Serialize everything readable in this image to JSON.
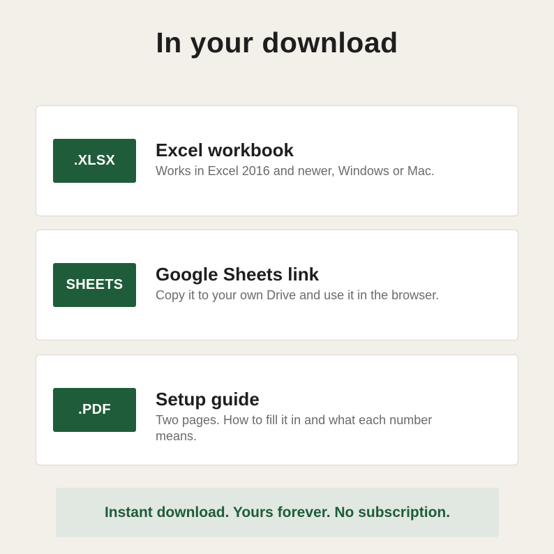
{
  "page": {
    "title": "In your download"
  },
  "items": [
    {
      "badge": ".XLSX",
      "title": "Excel workbook",
      "description": "Works in Excel 2016 and newer, Windows or Mac."
    },
    {
      "badge": "SHEETS",
      "title": "Google Sheets link",
      "description": "Copy it to your own Drive and use it in the browser."
    },
    {
      "badge": ".PDF",
      "title": "Setup guide",
      "description": "Two pages. How to fill it in and what each number means."
    }
  ],
  "footer": {
    "text": "Instant download. Yours forever. No subscription."
  },
  "colors": {
    "background": "#f3f0e9",
    "accent": "#1f5c3a",
    "banner": "#e1e8e1"
  }
}
